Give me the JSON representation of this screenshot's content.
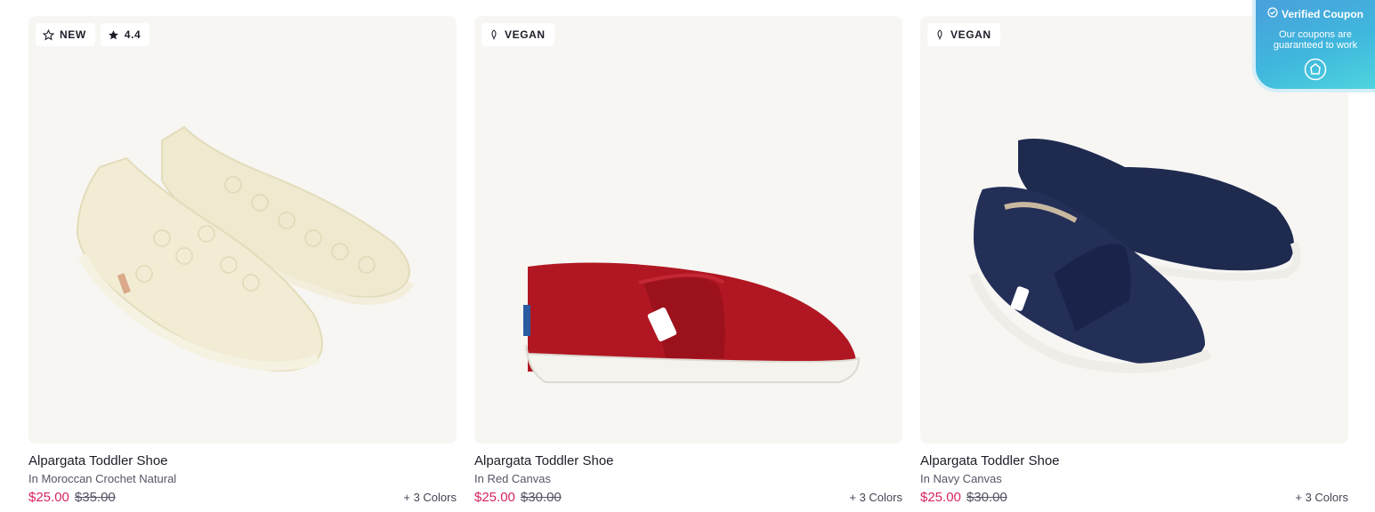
{
  "products": [
    {
      "badges": [
        {
          "icon": "star-outline-icon",
          "label": "NEW"
        },
        {
          "icon": "star-filled-icon",
          "label": "4.4"
        }
      ],
      "title": "Alpargata Toddler Shoe",
      "variant": "In Moroccan Crochet Natural",
      "sale_price": "$25.00",
      "original_price": "$35.00",
      "colors": "+ 3 Colors",
      "shoe_color": "#efe9cf"
    },
    {
      "badges": [
        {
          "icon": "leaf-icon",
          "label": "VEGAN"
        }
      ],
      "title": "Alpargata Toddler Shoe",
      "variant": "In Red Canvas",
      "sale_price": "$25.00",
      "original_price": "$30.00",
      "colors": "+ 3 Colors",
      "shoe_color": "#b01722"
    },
    {
      "badges": [
        {
          "icon": "leaf-icon",
          "label": "VEGAN"
        }
      ],
      "title": "Alpargata Toddler Shoe",
      "variant": "In Navy Canvas",
      "sale_price": "$25.00",
      "original_price": "$30.00",
      "colors": "+ 3 Colors",
      "shoe_color": "#1f2a4f"
    }
  ],
  "coupon": {
    "title": "Verified Coupon",
    "text": "Our coupons are guaranteed to work",
    "icon": "coupon-badge-icon"
  },
  "colors": {
    "sale_price": "#d6245f",
    "card_background": "#f7f6f3"
  }
}
